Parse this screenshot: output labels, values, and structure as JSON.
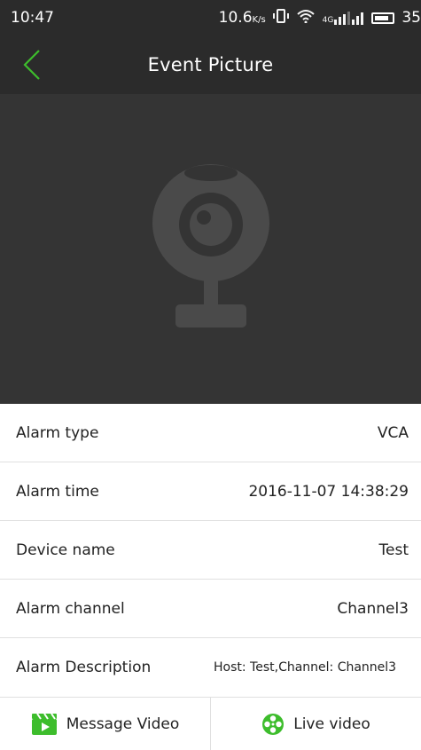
{
  "status_bar": {
    "time": "10:47",
    "network_speed": "10.6",
    "network_speed_unit": "K/s",
    "signal_label": "4G",
    "battery_level": "35",
    "icons": [
      "vibrate-icon",
      "wifi-icon",
      "cell-signal-icon",
      "battery-icon"
    ]
  },
  "app_bar": {
    "title": "Event Picture",
    "back_icon": "chevron-left-icon",
    "accent_color": "#3dbd2c"
  },
  "picture": {
    "placeholder_icon": "webcam-icon",
    "background_color": "#343434"
  },
  "details": [
    {
      "label": "Alarm type",
      "value": "VCA"
    },
    {
      "label": "Alarm time",
      "value": "2016-11-07 14:38:29"
    },
    {
      "label": "Device name",
      "value": "Test"
    },
    {
      "label": "Alarm channel",
      "value": "Channel3"
    },
    {
      "label": "Alarm Description",
      "value": "Host: Test,Channel: Channel3"
    }
  ],
  "bottom_bar": {
    "message_video": {
      "label": "Message Video",
      "icon": "clapperboard-icon"
    },
    "live_video": {
      "label": "Live video",
      "icon": "film-reel-icon"
    }
  }
}
